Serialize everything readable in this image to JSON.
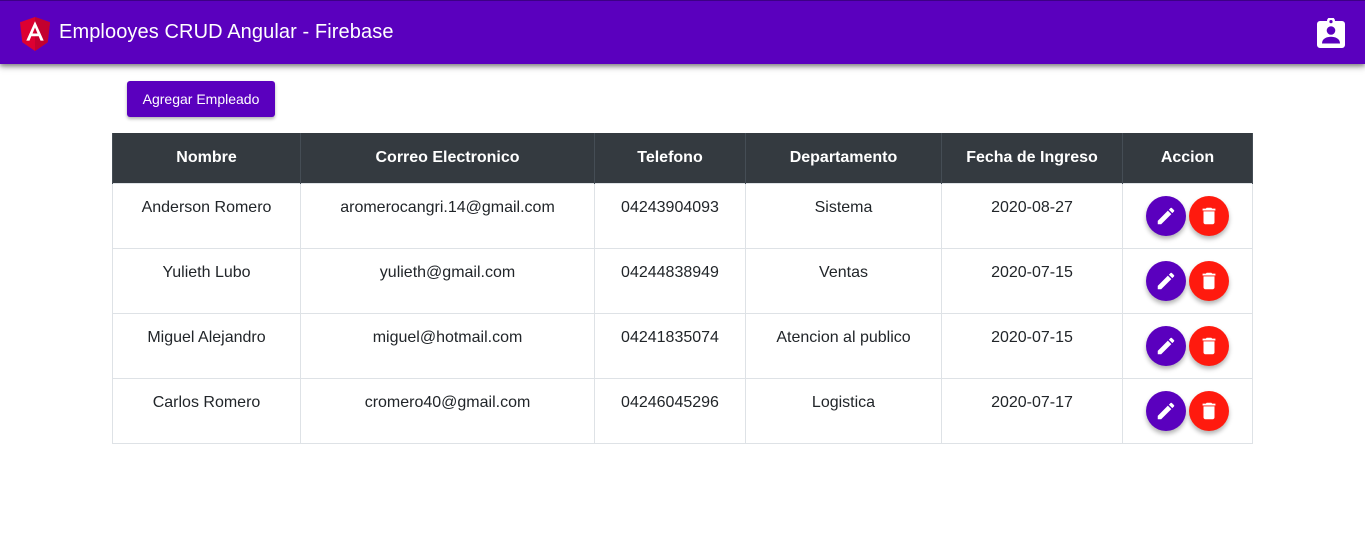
{
  "toolbar": {
    "title": "Emplooyes CRUD Angular - Firebase",
    "logo_icon": "angular-logo",
    "right_icon": "assignment-ind-icon",
    "color": "#5a00be"
  },
  "actions": {
    "add_label": "Agregar Empleado"
  },
  "table": {
    "headers": [
      "Nombre",
      "Correo Electronico",
      "Telefono",
      "Departamento",
      "Fecha de Ingreso",
      "Accion"
    ],
    "rows": [
      [
        "Anderson Romero",
        "aromerocangri.14@gmail.com",
        "04243904093",
        "Sistema",
        "2020-08-27"
      ],
      [
        "Yulieth Lubo",
        "yulieth@gmail.com",
        "04244838949",
        "Ventas",
        "2020-07-15"
      ],
      [
        "Miguel Alejandro",
        "miguel@hotmail.com",
        "04241835074",
        "Atencion al publico",
        "2020-07-15"
      ],
      [
        "Carlos Romero",
        "cromero40@gmail.com",
        "04246045296",
        "Logistica",
        "2020-07-17"
      ]
    ],
    "row_action_icons": [
      "edit-icon",
      "delete-icon"
    ],
    "header_bg": "#343a40",
    "edit_color": "#5a00be",
    "delete_color": "#ff1a0e"
  }
}
